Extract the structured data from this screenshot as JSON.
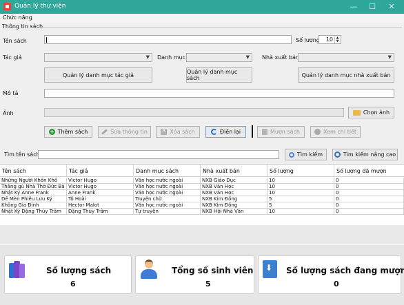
{
  "window": {
    "title": "Quản lý thư viện",
    "minimize": "—",
    "maximize": "☐",
    "close": "✕"
  },
  "menu": {
    "label": "Chức năng"
  },
  "form": {
    "group_title": "Thông tin sách",
    "book_name_label": "Tên sách",
    "quantity_label": "Số lượng",
    "quantity_value": "10",
    "author_label": "Tác giả",
    "category_label": "Danh mục",
    "publisher_label": "Nhà xuất bản",
    "manage_author": "Quản lý danh mục tác giả",
    "manage_category": "Quản lý danh mục sách",
    "manage_publisher": "Quản lý danh mục nhà xuất bản",
    "description_label": "Mô tả",
    "image_label": "Ảnh",
    "choose_image": "Chọn ảnh"
  },
  "actions": {
    "add": "Thêm sách",
    "edit": "Sửa thông tin",
    "delete": "Xóa sách",
    "reload": "Điền lại",
    "borrow": "Mượn sách",
    "detail": "Xem chi tiết"
  },
  "search": {
    "label": "Tìm tên sách",
    "button": "Tìm kiếm",
    "advanced": "Tìm kiếm nâng cao"
  },
  "table": {
    "columns": [
      "Tên sách",
      "Tác giả",
      "Danh mục sách",
      "Nhà xuất bản",
      "Số lượng",
      "Số lượng đã mượn"
    ],
    "rows": [
      [
        "Những Người Khốn Khổ",
        "Victor Hugo",
        "Văn học nước ngoài",
        "NXB Giáo Dục",
        "10",
        "0"
      ],
      [
        "Thằng gù Nhà Thờ Đức Bà",
        "Victor Hugo",
        "Văn học nước ngoài",
        "NXB Văn Học",
        "10",
        "0"
      ],
      [
        "Nhật Ký Anne Frank",
        "Anne Frank",
        "Văn học nước ngoài",
        "NXB Văn Học",
        "10",
        "0"
      ],
      [
        "Dế Mèn Phiêu Lưu Ký",
        "Tô Hoài",
        "Truyện chữ",
        "NXB Kim Đồng",
        "5",
        "0"
      ],
      [
        "Không Gia Đình",
        "Hector Malot",
        "Văn học nước ngoài",
        "NXB Kim Đồng",
        "5",
        "0"
      ],
      [
        "Nhật Ký Đặng Thùy Trâm",
        "Đặng Thùy Trâm",
        "Tự truyện",
        "NXB Hội Nhà Văn",
        "10",
        "0"
      ]
    ]
  },
  "stats": [
    {
      "label": "Số lượng sách",
      "value": "6"
    },
    {
      "label": "Tổng số sinh viên",
      "value": "5"
    },
    {
      "label": "Số lượng sách đang mượn",
      "value": "0"
    }
  ],
  "colors": {
    "titlebar": "#2fa89b",
    "add_icon": "#2e9a3a",
    "accent_blue": "#3a7fd0",
    "books_icon": "#7a45c8"
  },
  "icons": {
    "add": "plus-circle-icon",
    "edit": "pencil-icon",
    "delete": "x-icon",
    "reload": "refresh-icon",
    "borrow": "book-icon",
    "detail": "eye-icon",
    "choose_image": "folder-icon",
    "search": "search-icon",
    "advanced": "search-advanced-icon",
    "books": "books-icon",
    "students": "user-icon",
    "borrowed": "download-icon"
  }
}
